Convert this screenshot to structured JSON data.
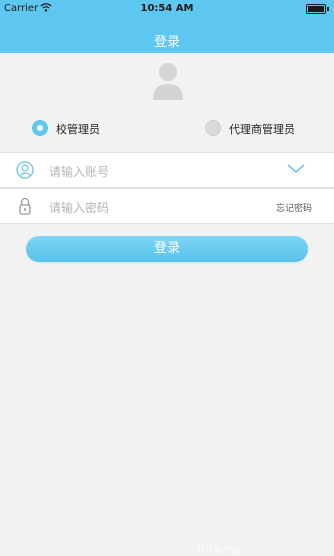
{
  "status_bar": {
    "carrier": "Carrier",
    "time": "10:54 AM"
  },
  "nav": {
    "title": "登录"
  },
  "roles": [
    {
      "label": "校管理员",
      "selected": true
    },
    {
      "label": "代理商管理员",
      "selected": false
    }
  ],
  "account": {
    "placeholder": "请输入账号",
    "icon": "user-icon"
  },
  "password": {
    "placeholder": "请输入密码",
    "icon": "lock-icon",
    "forgot_label": "忘记密码"
  },
  "login_button": {
    "label": "登录"
  },
  "watermark": {
    "text": "非凡软件站"
  },
  "colors": {
    "accent": "#5ec7ef",
    "background": "#f2f2f2"
  }
}
